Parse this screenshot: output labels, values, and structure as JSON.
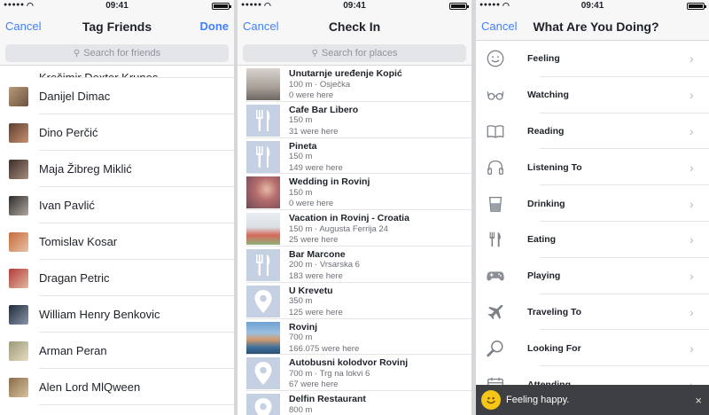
{
  "status": {
    "time": "09:41",
    "signal": "●●●●●"
  },
  "tag_friends": {
    "cancel": "Cancel",
    "title": "Tag Friends",
    "done": "Done",
    "search_placeholder": "Search for friends",
    "friends": [
      "Krešimir Dexter Krunes",
      "Danijel Dimac",
      "Dino Perčić",
      "Maja Žibreg Miklić",
      "Ivan Pavlić",
      "Tomislav Kosar",
      "Dragan Petric",
      "William Henry Benkovic",
      "Arman Peran",
      "Alen Lord MlQween"
    ]
  },
  "check_in": {
    "cancel": "Cancel",
    "title": "Check In",
    "search_placeholder": "Search for places",
    "places": [
      {
        "name": "Unutarnje uređenje Kopić",
        "detail": "100 m · Osječka",
        "count": "0 were here"
      },
      {
        "name": "Cafe Bar Libero",
        "detail": "150 m",
        "count": "31 were here"
      },
      {
        "name": "Pineta",
        "detail": "150 m",
        "count": "149 were here"
      },
      {
        "name": "Wedding in Rovinj",
        "detail": "150 m",
        "count": "0 were here"
      },
      {
        "name": "Vacation in Rovinj - Croatia",
        "detail": "150 m · Augusta Ferrija 24",
        "count": "25 were here"
      },
      {
        "name": "Bar Marcone",
        "detail": "200 m · Vrsarska 6",
        "count": "183 were here"
      },
      {
        "name": "U Krevetu",
        "detail": "350 m",
        "count": "125 were here"
      },
      {
        "name": "Rovinj",
        "detail": "700 m",
        "count": "166.075 were here"
      },
      {
        "name": "Autobusni kolodvor Rovinj",
        "detail": "700 m · Trg na lokvi 6",
        "count": "67 were here"
      },
      {
        "name": "Delfin Restaurant",
        "detail": "800 m",
        "count": ""
      }
    ]
  },
  "doing": {
    "cancel": "Cancel",
    "title": "What Are You Doing?",
    "activities": [
      {
        "label": "Feeling",
        "icon": "smiley-icon"
      },
      {
        "label": "Watching",
        "icon": "glasses-icon"
      },
      {
        "label": "Reading",
        "icon": "book-icon"
      },
      {
        "label": "Listening To",
        "icon": "headphones-icon"
      },
      {
        "label": "Drinking",
        "icon": "cup-icon"
      },
      {
        "label": "Eating",
        "icon": "fork-knife-icon"
      },
      {
        "label": "Playing",
        "icon": "gamepad-icon"
      },
      {
        "label": "Traveling To",
        "icon": "airplane-icon"
      },
      {
        "label": "Looking For",
        "icon": "magnifier-icon"
      },
      {
        "label": "Attending",
        "icon": "calendar-icon"
      }
    ],
    "toast": "Feeling happy.",
    "chevron": "›",
    "close": "×"
  },
  "colors": {
    "accent": "#4080ff",
    "nav_bg": "#f7f7f7",
    "thumb_bg": "#c6d0e3",
    "toast_bg": "#3e3f42"
  }
}
